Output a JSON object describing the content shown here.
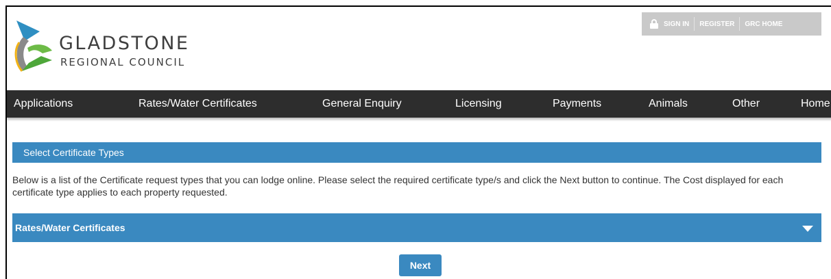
{
  "header": {
    "logo_title": "GLADSTONE",
    "logo_subtitle": "REGIONAL COUNCIL",
    "top_links": {
      "sign_in": "SIGN IN",
      "register": "REGISTER",
      "grc_home": "GRC HOME"
    }
  },
  "nav": {
    "items": [
      "Applications",
      "Rates/Water Certificates",
      "General Enquiry",
      "Licensing",
      "Payments",
      "Animals",
      "Other",
      "Home"
    ]
  },
  "main": {
    "section_title": "Select Certificate Types",
    "description": "Below is a list of the Certificate request types that you can lodge online. Please select the required certificate type/s and click the Next button to continue. The Cost displayed for each certificate type applies to each property requested.",
    "accordion_label": "Rates/Water Certificates",
    "next_label": "Next"
  },
  "colors": {
    "nav_bg": "#2d2d2d",
    "accent_blue": "#3a89c0",
    "top_links_bg": "#c9c9c9"
  }
}
